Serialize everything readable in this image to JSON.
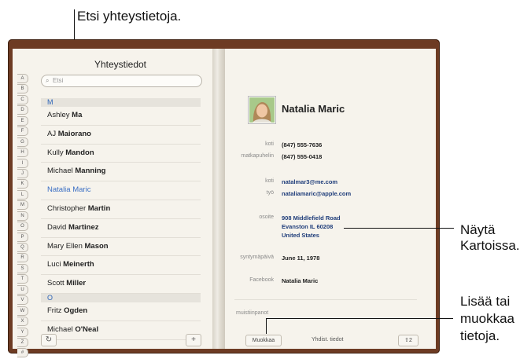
{
  "callouts": {
    "search": "Etsi yhteystietoja.",
    "map_line1": "Näytä",
    "map_line2": "Kartoissa.",
    "edit_line1": "Lisää tai",
    "edit_line2": "muokkaa",
    "edit_line3": "tietoja."
  },
  "contacts_app": {
    "title": "Yhteystiedot",
    "search_placeholder": "Etsi",
    "index_letters": [
      "A",
      "B",
      "C",
      "D",
      "E",
      "F",
      "G",
      "H",
      "I",
      "J",
      "K",
      "L",
      "M",
      "N",
      "O",
      "P",
      "Q",
      "R",
      "S",
      "T",
      "U",
      "V",
      "W",
      "X",
      "Y",
      "Z",
      "#"
    ],
    "section_m": "M",
    "section_o": "O",
    "list_m": [
      {
        "first": "Ashley",
        "last": "Ma"
      },
      {
        "first": "AJ",
        "last": "Maiorano"
      },
      {
        "first": "Kully",
        "last": "Mandon"
      },
      {
        "first": "Michael",
        "last": "Manning"
      },
      {
        "first": "Natalia",
        "last": "Maric",
        "selected": true
      },
      {
        "first": "Christopher",
        "last": "Martin"
      },
      {
        "first": "David",
        "last": "Martinez"
      },
      {
        "first": "Mary Ellen",
        "last": "Mason"
      },
      {
        "first": "Luci",
        "last": "Meinerth"
      },
      {
        "first": "Scott",
        "last": "Miller"
      }
    ],
    "list_o": [
      {
        "first": "Fritz",
        "last": "Ogden"
      },
      {
        "first": "Michael",
        "last": "O'Neal"
      }
    ],
    "refresh_icon": "↻",
    "add_icon": "+"
  },
  "detail": {
    "name": "Natalia Maric",
    "home_phone_label": "koti",
    "home_phone": "(847) 555-7636",
    "mobile_label": "matkapuhelin",
    "mobile": "(847) 555-0418",
    "home_email_label": "koti",
    "home_email": "natalmar3@me.com",
    "work_email_label": "työ",
    "work_email": "nataliamaric@apple.com",
    "address_label": "osoite",
    "address_line1": "908 Middlefield Road",
    "address_line2": "Evanston IL 60208",
    "address_line3": "United States",
    "birthday_label": "syntymäpäivä",
    "birthday": "June 11, 1978",
    "facebook_label": "Facebook",
    "facebook": "Natalia Maric",
    "notes_label": "muistiinpanot",
    "edit_button": "Muokkaa",
    "merge_label": "Yhdist. tiedot",
    "share_icon": "⇧",
    "share_count": "2"
  },
  "colors": {
    "leather": "#6d3b23",
    "paper": "#f6f3ec",
    "selected_text": "#3b6fc4",
    "section_letter": "#2e65b8"
  }
}
